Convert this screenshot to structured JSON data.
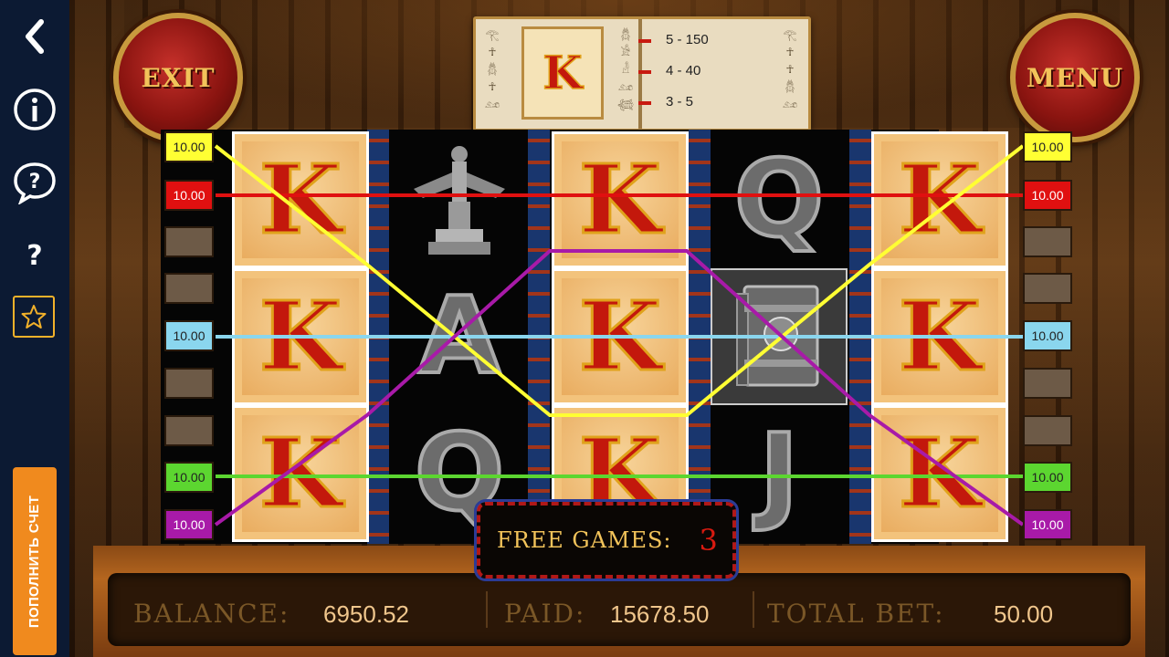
{
  "sidebar": {
    "back_icon": "chevron-left",
    "info_icon": "info-circle",
    "help_icon": "question-bubble",
    "question_label": "?",
    "favorite_icon": "star",
    "topup_label": "ПОПОЛНИТЬ СЧЕТ"
  },
  "header": {
    "exit_label": "EXIT",
    "menu_label": "MENU"
  },
  "paytable": {
    "symbol": "K",
    "rows": [
      {
        "label": "5 - 150"
      },
      {
        "label": "4 - 40"
      },
      {
        "label": "3 - 5"
      }
    ]
  },
  "reels": {
    "grid": [
      [
        "K",
        "statue",
        "K",
        "Q",
        "K"
      ],
      [
        "K",
        "A",
        "K",
        "book",
        "K"
      ],
      [
        "K",
        "Q",
        "K",
        "J",
        "K"
      ]
    ]
  },
  "lines": {
    "left_tabs": [
      "10.00",
      "10.00",
      "",
      "",
      "10.00",
      "",
      "",
      "10.00",
      "10.00"
    ],
    "right_tabs": [
      "10.00",
      "10.00",
      "",
      "",
      "10.00",
      "",
      "",
      "10.00",
      "10.00"
    ],
    "tab_colors": [
      "#ffff33",
      "#e01010",
      "",
      "",
      "#8ad6ee",
      "",
      "",
      "#5cd630",
      "#a81aa8"
    ]
  },
  "free_games": {
    "label": "FREE GAMES:",
    "count": "3"
  },
  "status": {
    "balance_label": "BALANCE:",
    "balance_value": "6950.52",
    "paid_label": "PAID:",
    "paid_value": "15678.50",
    "total_bet_label": "TOTAL BET:",
    "total_bet_value": "50.00"
  },
  "colors": {
    "sidebar_bg": "#0c1a33",
    "topup_bg": "#f08a1e",
    "accent_gold": "#f2c35a"
  }
}
